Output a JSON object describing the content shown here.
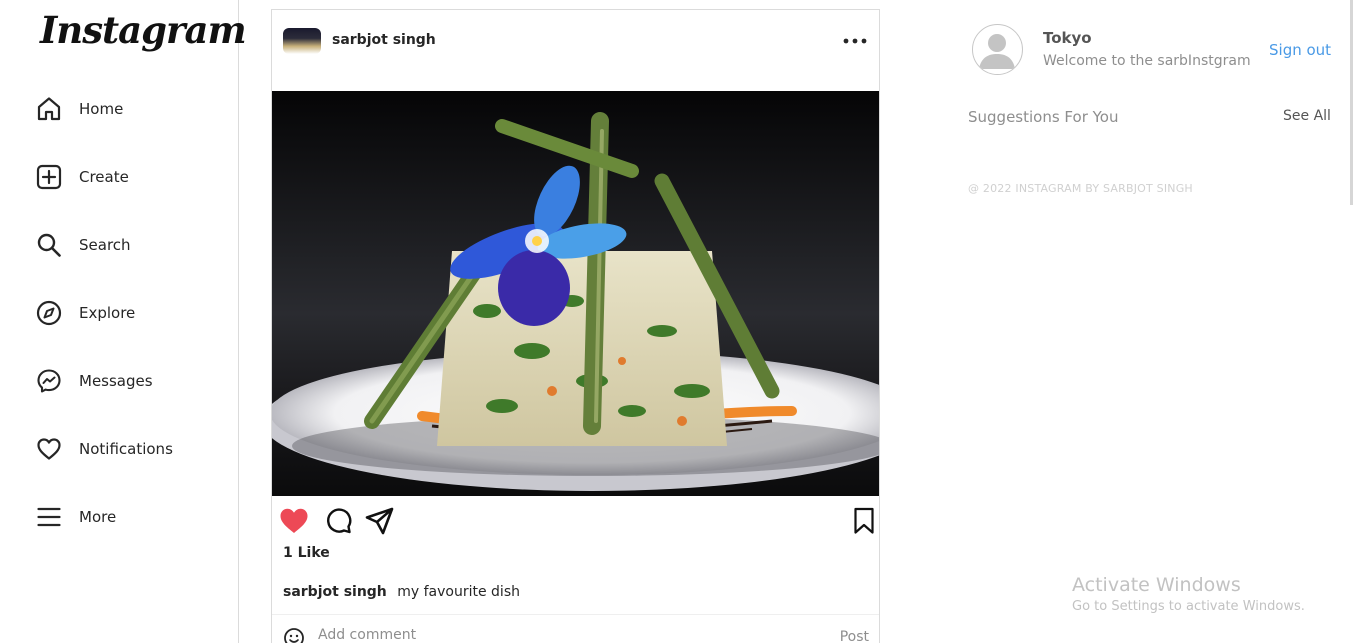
{
  "brand": {
    "logo_text": "Instagram"
  },
  "sidebar": {
    "items": [
      {
        "label": "Home",
        "icon": "home-icon"
      },
      {
        "label": "Create",
        "icon": "create-icon"
      },
      {
        "label": "Search",
        "icon": "search-icon"
      },
      {
        "label": "Explore",
        "icon": "explore-icon"
      },
      {
        "label": "Messages",
        "icon": "messages-icon"
      },
      {
        "label": "Notifications",
        "icon": "heart-icon"
      },
      {
        "label": "More",
        "icon": "menu-icon"
      }
    ]
  },
  "post": {
    "username": "sarbjot singh",
    "likes_text": "1 Like",
    "caption_user": "sarbjot singh",
    "caption_text": "my favourite dish",
    "liked": true,
    "comment_placeholder": "Add comment",
    "post_button": "Post"
  },
  "profile": {
    "name": "Tokyo",
    "subtitle": "Welcome to the sarbInstgram",
    "signout": "Sign out"
  },
  "suggestions": {
    "title": "Suggestions For You",
    "see_all": "See All"
  },
  "footer": {
    "copyright": "@ 2022 INSTAGRAM BY SARBJOT SINGH"
  },
  "watermark": {
    "title": "Activate Windows",
    "subtitle": "Go to Settings to activate Windows."
  },
  "colors": {
    "like": "#ed4956",
    "link": "#4a9ae6",
    "border": "#dbdbdb"
  }
}
